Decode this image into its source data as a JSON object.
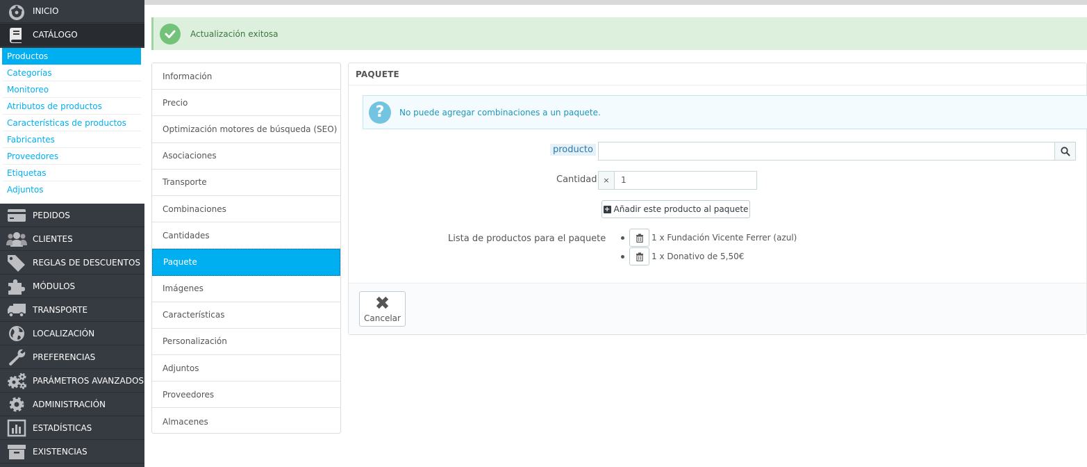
{
  "sidebar": {
    "items": [
      {
        "label": "INICIO",
        "icon": "dashboard-icon"
      },
      {
        "label": "CATÁLOGO",
        "icon": "book-icon"
      },
      {
        "label": "PEDIDOS",
        "icon": "credit-card-icon"
      },
      {
        "label": "CLIENTES",
        "icon": "users-icon"
      },
      {
        "label": "REGLAS DE DESCUENTOS",
        "icon": "tags-icon"
      },
      {
        "label": "MÓDULOS",
        "icon": "puzzle-icon"
      },
      {
        "label": "TRANSPORTE",
        "icon": "truck-icon"
      },
      {
        "label": "LOCALIZACIÓN",
        "icon": "globe-icon"
      },
      {
        "label": "PREFERENCIAS",
        "icon": "wrench-icon"
      },
      {
        "label": "PARÁMETROS AVANZADOS",
        "icon": "cogs-icon"
      },
      {
        "label": "ADMINISTRACIÓN",
        "icon": "cog-icon"
      },
      {
        "label": "ESTADÍSTICAS",
        "icon": "bar-chart-icon"
      },
      {
        "label": "EXISTENCIAS",
        "icon": "archive-icon"
      }
    ],
    "submenu": [
      "Productos",
      "Categorías",
      "Monitoreo",
      "Atributos de productos",
      "Características de productos",
      "Fabricantes",
      "Proveedores",
      "Etiquetas",
      "Adjuntos"
    ]
  },
  "alert": {
    "text": "Actualización exitosa"
  },
  "tabs": [
    "Información",
    "Precio",
    "Optimización motores de búsqueda (SEO)",
    "Asociaciones",
    "Transporte",
    "Combinaciones",
    "Cantidades",
    "Paquete",
    "Imágenes",
    "Características",
    "Personalización",
    "Adjuntos",
    "Proveedores",
    "Almacenes"
  ],
  "panel": {
    "heading": "PAQUETE",
    "info": "No puede agregar combinaciones a un paquete.",
    "product_label": "producto",
    "product_value": "",
    "quantity_label": "Cantidad",
    "quantity_addon": "×",
    "quantity_value": "1",
    "add_button": "Añadir este producto al paquete",
    "list_label": "Lista de productos para el paquete",
    "pack_items": [
      "1 x Fundación Vicente Ferrer (azul)",
      "1 x Donativo de 5,50€"
    ],
    "cancel_button": "Cancelar"
  },
  "colors": {
    "sidebar_bg": "#363a41",
    "accent": "#00aff0",
    "success_bg": "#ddf0de",
    "info_text": "#1d96b8"
  }
}
